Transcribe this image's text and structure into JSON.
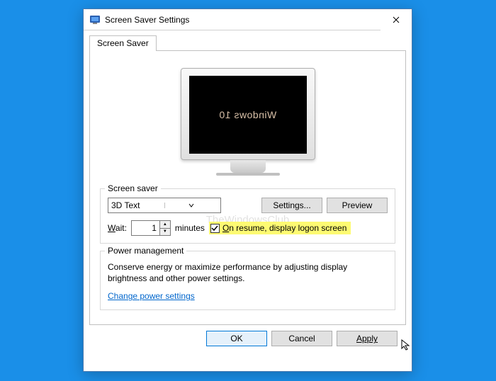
{
  "window": {
    "title": "Screen Saver Settings"
  },
  "tabs": {
    "screen_saver": "Screen Saver"
  },
  "preview_screen_text": "Windows 10",
  "watermark": "TheWindowsClub",
  "screen_saver_group": {
    "legend": "Screen saver",
    "selected": "3D Text",
    "settings_btn": "Settings...",
    "preview_btn": "Preview",
    "wait_label_pre": "W",
    "wait_label_post": "ait:",
    "wait_value": "1",
    "minutes_label": "minutes",
    "on_resume_checked": true,
    "on_resume_pre": "O",
    "on_resume_post": "n resume, display logon screen"
  },
  "power_group": {
    "legend": "Power management",
    "text": "Conserve energy or maximize performance by adjusting display brightness and other power settings.",
    "link": "Change power settings"
  },
  "buttons": {
    "ok": "OK",
    "cancel": "Cancel",
    "apply": "Apply"
  }
}
